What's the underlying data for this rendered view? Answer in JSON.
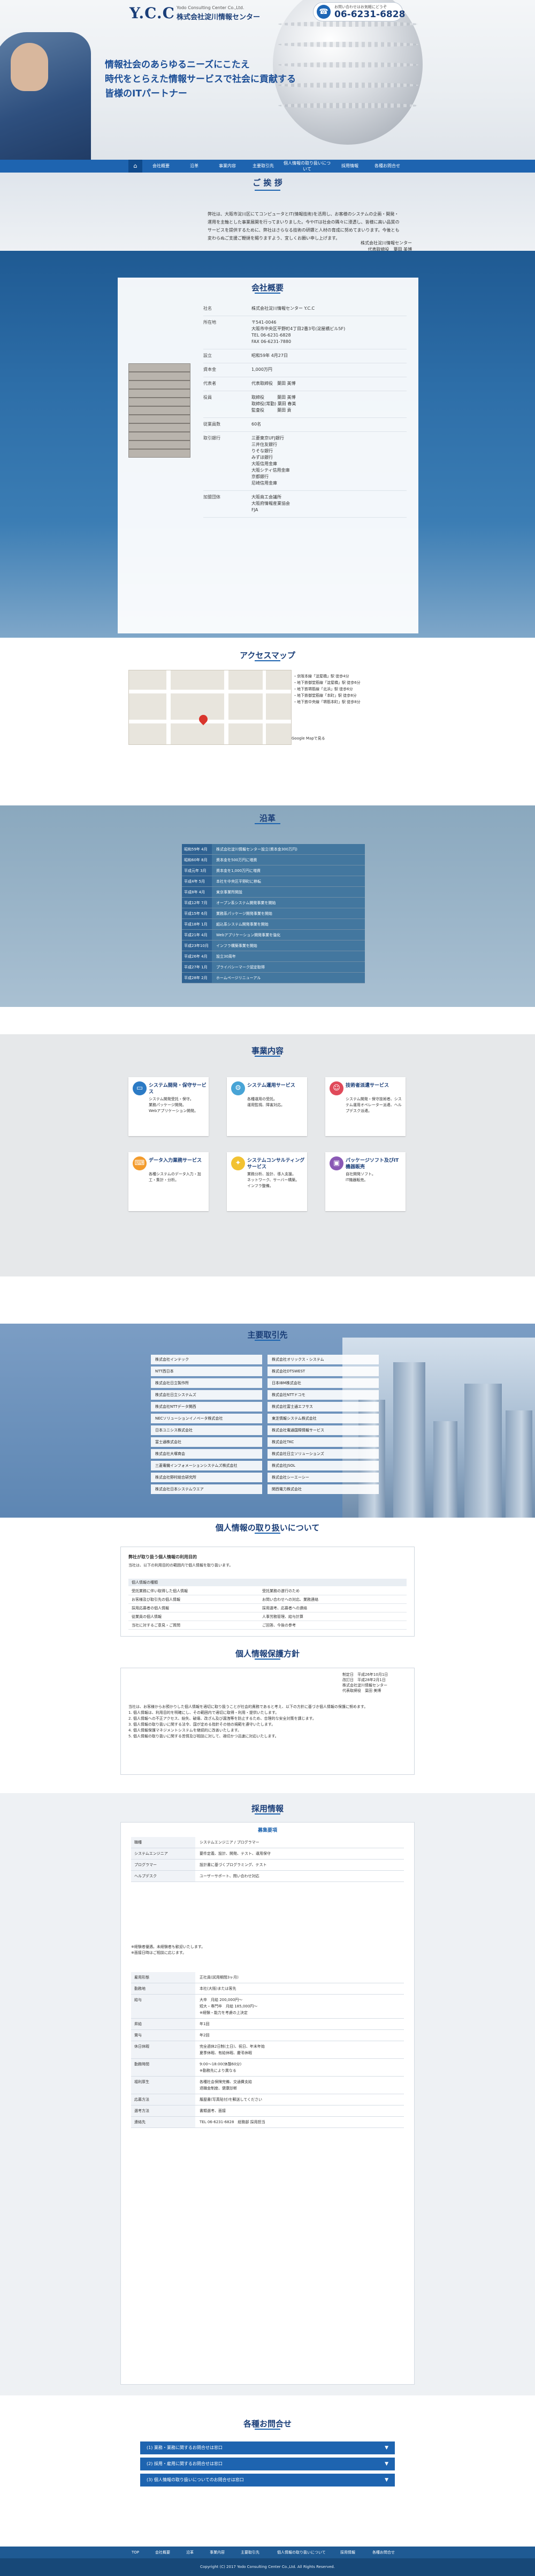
{
  "header": {
    "logo_mark": "Y.C.C",
    "logo_en": "Yodo Consulting Center Co.,Ltd.",
    "logo_jp": "株式会社淀川情報センター",
    "tel_note": "お問い合わせはお気軽にどうぞ",
    "tel_number": "06-6231-6828",
    "hero_lines": [
      "情報社会のあらゆるニーズにこたえ",
      "時代をとらえた情報サービスで社会に貢献する",
      "皆様のITパートナー"
    ]
  },
  "nav": {
    "home_icon": "home-icon",
    "items": [
      "会社概要",
      "沿革",
      "事業内容",
      "主要取引先",
      "個人情報の取り扱いについて",
      "採用情報",
      "各種お問合せ"
    ]
  },
  "greeting": {
    "title": "ご 挨 拶",
    "body": "弊社は、大阪市淀川区にてコンピュータとIT(情報技術)を活用し、お客様のシステムの企画・開発・運用を主軸とした事業展開を行ってまいりました。今やITは社会の隅々に浸透し、皆様に高い品質のサービスを提供するために、弊社はさらなる技術の研鑽と人材の育成に努めてまいります。今後とも変わらぬご支援ご鞭撻を賜りますよう、宜しくお願い申し上げます。",
    "sign_company": "株式会社淀川情報センター",
    "sign_name": "代表取締役　葉田 美博"
  },
  "overview": {
    "title": "会社概要",
    "rows": [
      {
        "k": "社名",
        "v": "株式会社淀川情報センター Y.C.C"
      },
      {
        "k": "所在地",
        "v": "〒541-0046\n大阪市中央区平野町4丁目2番3号(淀屋橋ビル5F)\nTEL 06-6231-6828\nFAX 06-6231-7880"
      },
      {
        "k": "設立",
        "v": "昭和59年 4月27日"
      },
      {
        "k": "資本金",
        "v": "1,000万円"
      },
      {
        "k": "代表者",
        "v": "代表取締役　葉田 美博"
      },
      {
        "k": "役員",
        "v": "取締役　　　葉田 美博\n取締役(常勤) 葉田 春美\n監査役　　　葉田 貢"
      },
      {
        "k": "従業員数",
        "v": "60名"
      },
      {
        "k": "取引銀行",
        "v": "三菱東京UFJ銀行\n三井住友銀行\nりそな銀行\nみずほ銀行\n大阪信用金庫\n大阪シティ信用金庫\n京都銀行\n尼崎信用金庫"
      },
      {
        "k": "加盟団体",
        "v": "大阪商工会議所\n大阪府情報産業協会\nFJA"
      }
    ]
  },
  "access": {
    "title": "アクセスマップ",
    "map_link": "Google Mapで見る",
    "lines": [
      "・京阪本線「淀屋橋」駅 徒歩4分",
      "・地下鉄御堂筋線「淀屋橋」駅 徒歩6分",
      "・地下鉄堺筋線「北浜」駅 徒歩6分",
      "・地下鉄御堂筋線「本町」駅 徒歩8分",
      "・地下鉄中央線「堺筋本町」駅 徒歩8分"
    ]
  },
  "history": {
    "title": "沿革",
    "rows": [
      {
        "d": "昭和59年 4月",
        "e": "株式会社淀川情報センター設立(資本金300万円)"
      },
      {
        "d": "昭和60年 8月",
        "e": "資本金を500万円に増資"
      },
      {
        "d": "平成元年 3月",
        "e": "資本金を1,000万円に増資"
      },
      {
        "d": "平成4年 5月",
        "e": "本社を中央区平野町に移転"
      },
      {
        "d": "平成8年 4月",
        "e": "東京事業所開設"
      },
      {
        "d": "平成12年 7月",
        "e": "オープン系システム開発事業を開始"
      },
      {
        "d": "平成15年 6月",
        "e": "業務系パッケージ開発事業を開始"
      },
      {
        "d": "平成18年 1月",
        "e": "組込系システム開発事業を開始"
      },
      {
        "d": "平成21年 4月",
        "e": "Webアプリケーション開発事業を強化"
      },
      {
        "d": "平成23年10月",
        "e": "インフラ構築事業を開始"
      },
      {
        "d": "平成26年 4月",
        "e": "設立30周年"
      },
      {
        "d": "平成27年 1月",
        "e": "プライバシーマーク認定取得"
      },
      {
        "d": "平成28年 2月",
        "e": "ホームページリニューアル"
      }
    ]
  },
  "business": {
    "title": "事業内容",
    "cards": [
      {
        "t": "システム開発・保守サービス",
        "b": "システム開発受託・保守。\n業務パッケージ開発。\nWebアプリケーション開発。",
        "c": "#2c7bc5",
        "i": "monitor-icon"
      },
      {
        "t": "システム運用サービス",
        "b": "各種運用の受託。\n運用監視、障害対応。",
        "c": "#48a4d6",
        "i": "gear-icon"
      },
      {
        "t": "技術者派遣サービス",
        "b": "システム開発・保守技術者、システム運用オペレーター派遣、ヘルプデスク派遣。",
        "c": "#e04a5a",
        "i": "people-icon"
      },
      {
        "t": "データ入力業務サービス",
        "b": "各種システムのデータ入力・加工・集計・分析。",
        "c": "#f39b2c",
        "i": "keyboard-icon"
      },
      {
        "t": "システムコンサルティングサービス",
        "b": "業務分析、設計、導入支援。\nネットワーク、サーバー構築。\nインフラ整備。",
        "c": "#f2c232",
        "i": "bulb-icon"
      },
      {
        "t": "パッケージソフト及びIT機器販売",
        "b": "自社開発ソフト。\nIT機器販売。",
        "c": "#8a59b5",
        "i": "box-icon"
      }
    ]
  },
  "clients": {
    "title": "主要取引先",
    "left": [
      "株式会社インテック",
      "NTT西日本",
      "株式会社日立製作所",
      "株式会社日立システムズ",
      "株式会社NTTデータ関西",
      "NECソリューションイノベータ株式会社",
      "日本ユニシス株式会社",
      "富士通株式会社",
      "株式会社大塚商会",
      "三菱電機インフォメーションシステムズ株式会社",
      "株式会社野村総合研究所",
      "株式会社日本システムウエア"
    ],
    "right": [
      "株式会社オリックス・システム",
      "株式会社DTSWEST",
      "日本IBM株式会社",
      "株式会社NTTドコモ",
      "株式会社富士通エフサス",
      "東芝情報システム株式会社",
      "株式会社電通国際情報サービス",
      "株式会社TKC",
      "株式会社日立ソリューションズ",
      "株式会社JSOL",
      "株式会社シーエーシー",
      "関西電力株式会社"
    ]
  },
  "privacy": {
    "title": "個人情報の取り扱いについて",
    "head": "弊社が取り扱う個人情報の利用目的",
    "intro": "当社は、以下の利用目的の範囲内で個人情報を取り扱います。",
    "th": "個人情報の種類",
    "rows": [
      {
        "a": "受託業務に伴い取得した個人情報",
        "b": "受託業務の遂行のため"
      },
      {
        "a": "お客様及び取引先の個人情報",
        "b": "お問い合わせへの対応、業務連絡"
      },
      {
        "a": "採用応募者の個人情報",
        "b": "採用選考、応募者への連絡"
      },
      {
        "a": "従業員の個人情報",
        "b": "人事労務管理、給与計算"
      },
      {
        "a": "当社に対するご意見・ご質問",
        "b": "ご回答、今後の参考"
      }
    ]
  },
  "policy": {
    "title": "個人情報保護方針",
    "meta": "制定日　平成26年10月1日\n改訂日　平成28年2月1日\n株式会社淀川情報センター\n代表取締役　葉田 美博",
    "body": "当社は、お客様からお預かりした個人情報を適切に取り扱うことが社会的責務であると考え、以下の方針に基づき個人情報の保護に努めます。\n1. 個人情報は、利用目的を明確にし、その範囲内で適切に取得・利用・提供いたします。\n2. 個人情報への不正アクセス、紛失、破壊、改ざん及び漏洩等を防止するため、合理的な安全対策を講じます。\n3. 個人情報の取り扱いに関する法令、国が定める指針その他の規範を遵守いたします。\n4. 個人情報保護マネジメントシステムを継続的に改善いたします。\n5. 個人情報の取り扱いに関する苦情及び相談に対して、適切かつ迅速に対応いたします。"
  },
  "recruit": {
    "title": "採用情報",
    "sub": "募集要項",
    "top": [
      {
        "k": "職種",
        "v": "システムエンジニア / プログラマー"
      },
      {
        "k": "システムエンジニア",
        "v": "要件定義、設計、開発、テスト、運用保守"
      },
      {
        "k": "プログラマー",
        "v": "設計書に基づくプログラミング、テスト"
      },
      {
        "k": "ヘルプデスク",
        "v": "ユーザーサポート、問い合わせ対応"
      }
    ],
    "note": "※経験者優遇。未経験者も歓迎いたします。\n※面接日時はご相談に応じます。",
    "bottom": [
      {
        "k": "雇用形態",
        "v": "正社員(試用期間3ヶ月)"
      },
      {
        "k": "勤務地",
        "v": "本社(大阪)または客先"
      },
      {
        "k": "給与",
        "v": "大卒　月給 200,000円〜\n短大・専門卒　月給 185,000円〜\n※経験・能力を考慮の上決定"
      },
      {
        "k": "昇給",
        "v": "年1回"
      },
      {
        "k": "賞与",
        "v": "年2回"
      },
      {
        "k": "休日休暇",
        "v": "完全週休2日制(土日)、祝日、年末年始\n夏季休暇、有給休暇、慶弔休暇"
      },
      {
        "k": "勤務時間",
        "v": "9:00〜18:00(休憩60分)\n※勤務先により異なる"
      },
      {
        "k": "福利厚生",
        "v": "各種社会保険完備、交通費支給\n退職金制度、健康診断"
      },
      {
        "k": "応募方法",
        "v": "履歴書(写真貼付)を郵送してください"
      },
      {
        "k": "選考方法",
        "v": "書類選考、面接"
      },
      {
        "k": "連絡先",
        "v": "TEL 06-6231-6828　総務部 採用担当"
      }
    ]
  },
  "contact": {
    "title": "各種お問合せ",
    "buttons": [
      "(1) 業務・業務に関するお問合せは窓口",
      "(2) 採用・雇用に関するお問合せは窓口",
      "(3) 個人情報の取り扱いについてのお問合せは窓口"
    ]
  },
  "footer": {
    "nav": [
      "TOP",
      "会社概要",
      "沿革",
      "事業内容",
      "主要取引先",
      "個人情報の取り扱いについて",
      "採用情報",
      "各種お問合せ"
    ],
    "copyright": "Copyright (C) 2017 Yodo Consulting Center Co.,Ltd. All Rights Reserved."
  }
}
